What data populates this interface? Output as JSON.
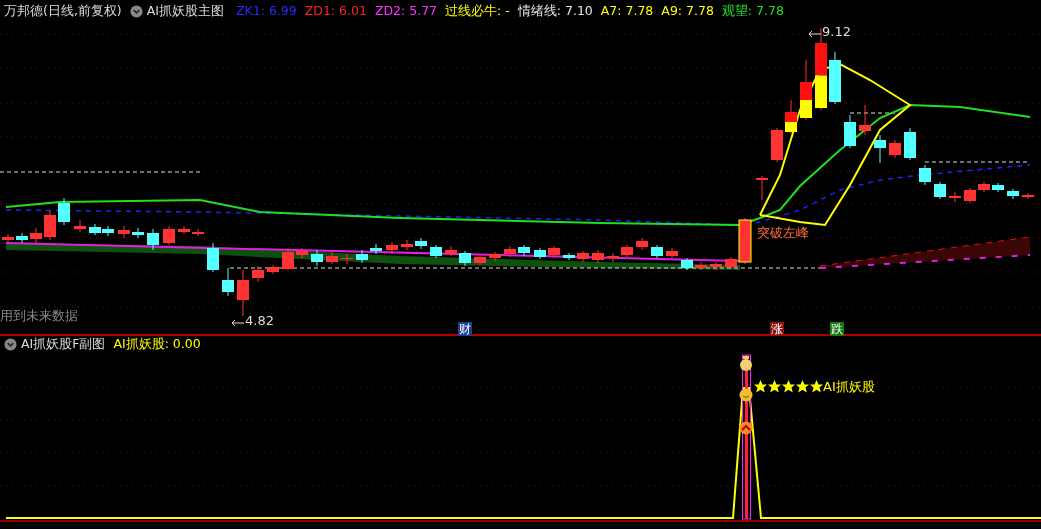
{
  "main_panel": {
    "title": "万邦德(日线,前复权)",
    "indicator_name": "AI抓妖股主图",
    "readings": [
      {
        "text": "ZK1: 6.99",
        "color": "#2a2aff"
      },
      {
        "text": "ZD1: 6.01",
        "color": "#ff2020"
      },
      {
        "text": "ZD2: 5.77",
        "color": "#ff30ff"
      },
      {
        "text": "过线必牛: -",
        "color": "#ffff00"
      },
      {
        "text": "情绪线: 7.10",
        "color": "#e8e8e8"
      },
      {
        "text": "A7: 7.78",
        "color": "#ffff00"
      },
      {
        "text": "A9: 7.78",
        "color": "#ffff00"
      },
      {
        "text": "观望: 7.78",
        "color": "#20e020"
      }
    ],
    "price_labels": [
      {
        "text": "9.12",
        "kind": "high"
      },
      {
        "text": "4.82",
        "kind": "low"
      }
    ],
    "signal_label": "突破左峰",
    "note": "用到未来数据",
    "event_markers": [
      {
        "text": "财",
        "color": "#1c3f8f"
      },
      {
        "text": "涨",
        "color": "#8b1010"
      },
      {
        "text": "跌",
        "color": "#137a13"
      }
    ]
  },
  "sub_panel": {
    "title": "AI抓妖股F副图",
    "readings": [
      {
        "text": "AI抓妖股: 0.00",
        "color": "#ffff00"
      }
    ],
    "signal": {
      "stars": 5,
      "text": "AI抓妖股"
    }
  }
}
